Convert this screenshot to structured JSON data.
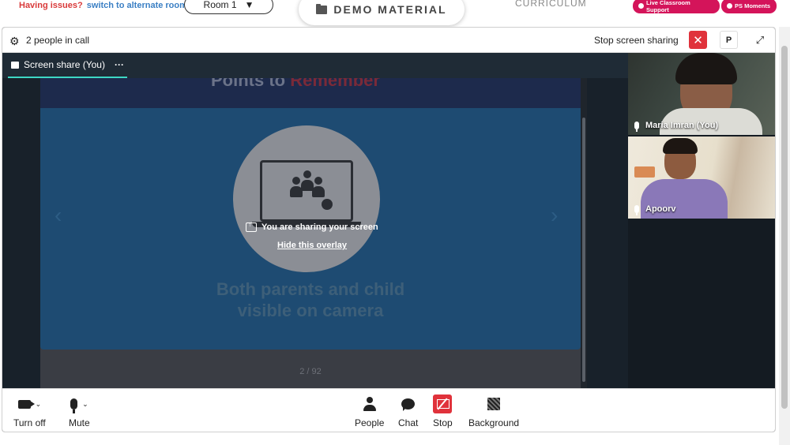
{
  "site": {
    "issues_text": "Having issues?",
    "alt_room_link": "switch to alternate room",
    "room_value": "Room 1",
    "demo_material": "DEMO MATERIAL",
    "curriculum": "CURRICULUM",
    "live_support": "Live Classroom Support",
    "ps_moments": "PS Moments"
  },
  "call": {
    "people_count": "2 people in call",
    "stop_sharing_label": "Stop screen sharing",
    "p_button": "P",
    "tab_label": "Screen share (You)",
    "tab_more": "···"
  },
  "slide": {
    "heading_part1": "Points to ",
    "heading_part2": "Remember",
    "share_message": "You are sharing your screen",
    "hide_overlay": "Hide this overlay",
    "caption_line1": "Both parents and child",
    "caption_line2": "visible on camera",
    "page": "2 / 92"
  },
  "participants": [
    {
      "name": "Maria Imran (You)"
    },
    {
      "name": "Apoorv"
    }
  ],
  "toolbar": {
    "camera": "Turn off",
    "mute": "Mute",
    "people": "People",
    "chat": "Chat",
    "stop": "Stop",
    "background": "Background"
  },
  "colors": {
    "accent_teal": "#3ed7c4",
    "danger_red": "#e0323b",
    "brand_pink": "#d4145a"
  }
}
